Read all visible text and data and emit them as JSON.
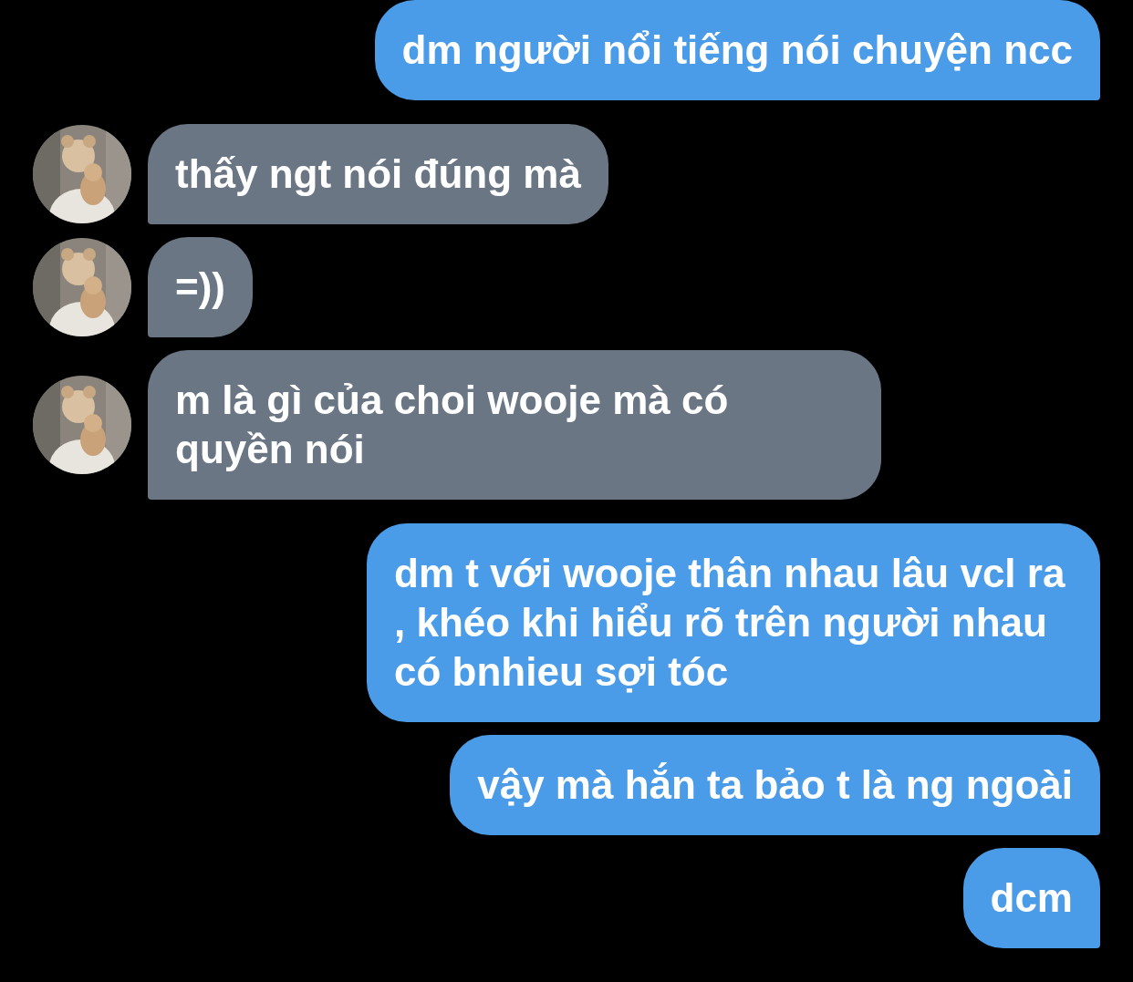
{
  "messages": [
    {
      "kind": "outgoing",
      "text": "dm người nổi tiếng nói chuyện ncc"
    },
    {
      "kind": "incoming",
      "text": "thấy ngt nói đúng mà"
    },
    {
      "kind": "incoming",
      "text": "=))"
    },
    {
      "kind": "incoming",
      "text": "m là gì của choi wooje mà có quyền nói"
    },
    {
      "kind": "outgoing",
      "text": "dm t với wooje thân nhau lâu vcl ra , khéo khi hiểu rõ trên người nhau có bnhieu sợi tóc"
    },
    {
      "kind": "outgoing",
      "text": "vậy mà hắn ta bảo t là ng ngoài"
    },
    {
      "kind": "outgoing",
      "text": "dcm"
    }
  ]
}
